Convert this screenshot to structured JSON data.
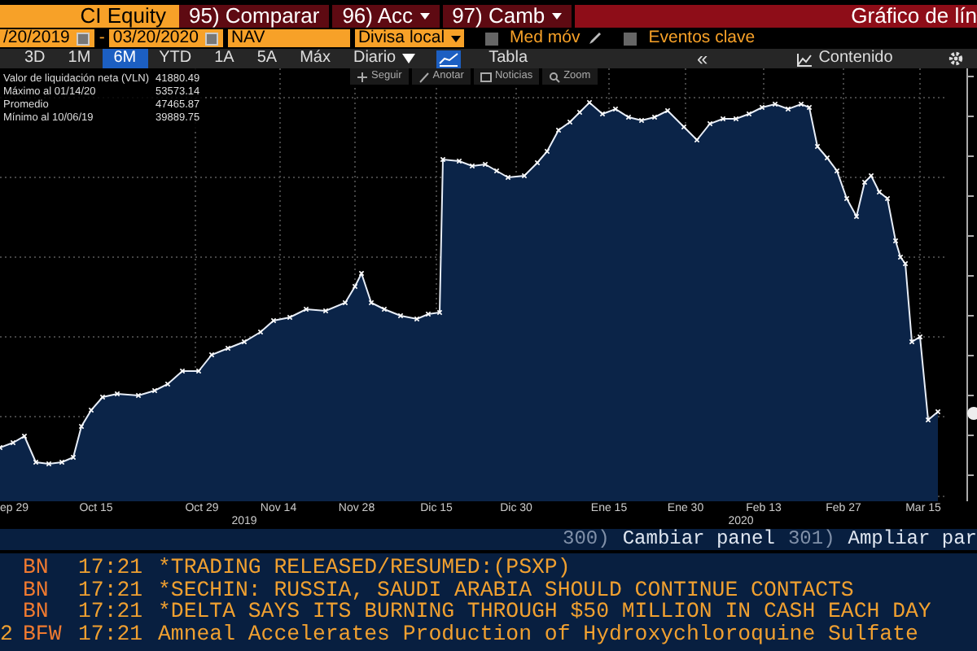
{
  "header": {
    "security": "CI Equity",
    "actions": [
      {
        "label": "95) Comparar",
        "dropdown": false
      },
      {
        "label": "96) Acc",
        "dropdown": true
      },
      {
        "label": "97) Camb",
        "dropdown": true
      }
    ],
    "title": "Gráfico de lín"
  },
  "filters": {
    "start_date": "/20/2019",
    "separator": "-",
    "end_date": "03/20/2020",
    "field": "NAV",
    "currency": "Divisa local",
    "options": [
      {
        "label": "Med móv",
        "checked": false,
        "kind": "pencil"
      },
      {
        "label": "Eventos clave",
        "checked": false,
        "kind": "plain"
      }
    ]
  },
  "toolbar": {
    "periods": [
      {
        "label": "3D",
        "selected": false
      },
      {
        "label": "1M",
        "selected": false
      },
      {
        "label": "6M",
        "selected": true
      },
      {
        "label": "YTD",
        "selected": false
      },
      {
        "label": "1A",
        "selected": false
      },
      {
        "label": "5A",
        "selected": false
      },
      {
        "label": "Máx",
        "selected": false
      }
    ],
    "frequency": "Diario",
    "view": "Tabla",
    "collapse": "«",
    "panel": "Contenido"
  },
  "legend": [
    {
      "label": "Valor de liquidación neta (VLN)",
      "value": "41880.49"
    },
    {
      "label": "Máximo al 01/14/20",
      "value": "53573.14"
    },
    {
      "label": "Promedio",
      "value": "47465.87"
    },
    {
      "label": "Mínimo al 10/06/19",
      "value": "39889.75"
    }
  ],
  "chart_actions": [
    {
      "label": "Seguir",
      "kind": "plus"
    },
    {
      "label": "Anotar",
      "kind": "pen"
    },
    {
      "label": "Noticias",
      "kind": "news"
    },
    {
      "label": "Zoom",
      "kind": "zoom"
    }
  ],
  "x_axis": {
    "labels": [
      "ep 29",
      "Oct 15",
      "Oct 29",
      "Nov 14",
      "Nov 28",
      "Dic 15",
      "Dic 30",
      "Ene 15",
      "Ene 30",
      "Feb 13",
      "Feb 27",
      "Mar 15"
    ],
    "years": [
      "2019",
      "2020"
    ]
  },
  "panel_actions": [
    {
      "number": "300)",
      "label": "Cambiar panel"
    },
    {
      "number": "301)",
      "label": "Ampliar par"
    }
  ],
  "news": [
    {
      "source": "BN",
      "time": "17:21",
      "headline": "*TRADING RELEASED/RESUMED:(PSXP)"
    },
    {
      "source": "BN",
      "time": "17:21",
      "headline": "*SECHIN: RUSSIA, SAUDI ARABIA SHOULD CONTINUE CONTACTS"
    },
    {
      "source": "BN",
      "time": "17:21",
      "headline": "*DELTA SAYS ITS BURNING THROUGH $50 MILLION IN CASH EACH DAY"
    },
    {
      "prefix": "2",
      "source": "BFW",
      "time": "17:21",
      "headline": "Amneal Accelerates Production of Hydroxychloroquine Sulfate"
    }
  ]
}
